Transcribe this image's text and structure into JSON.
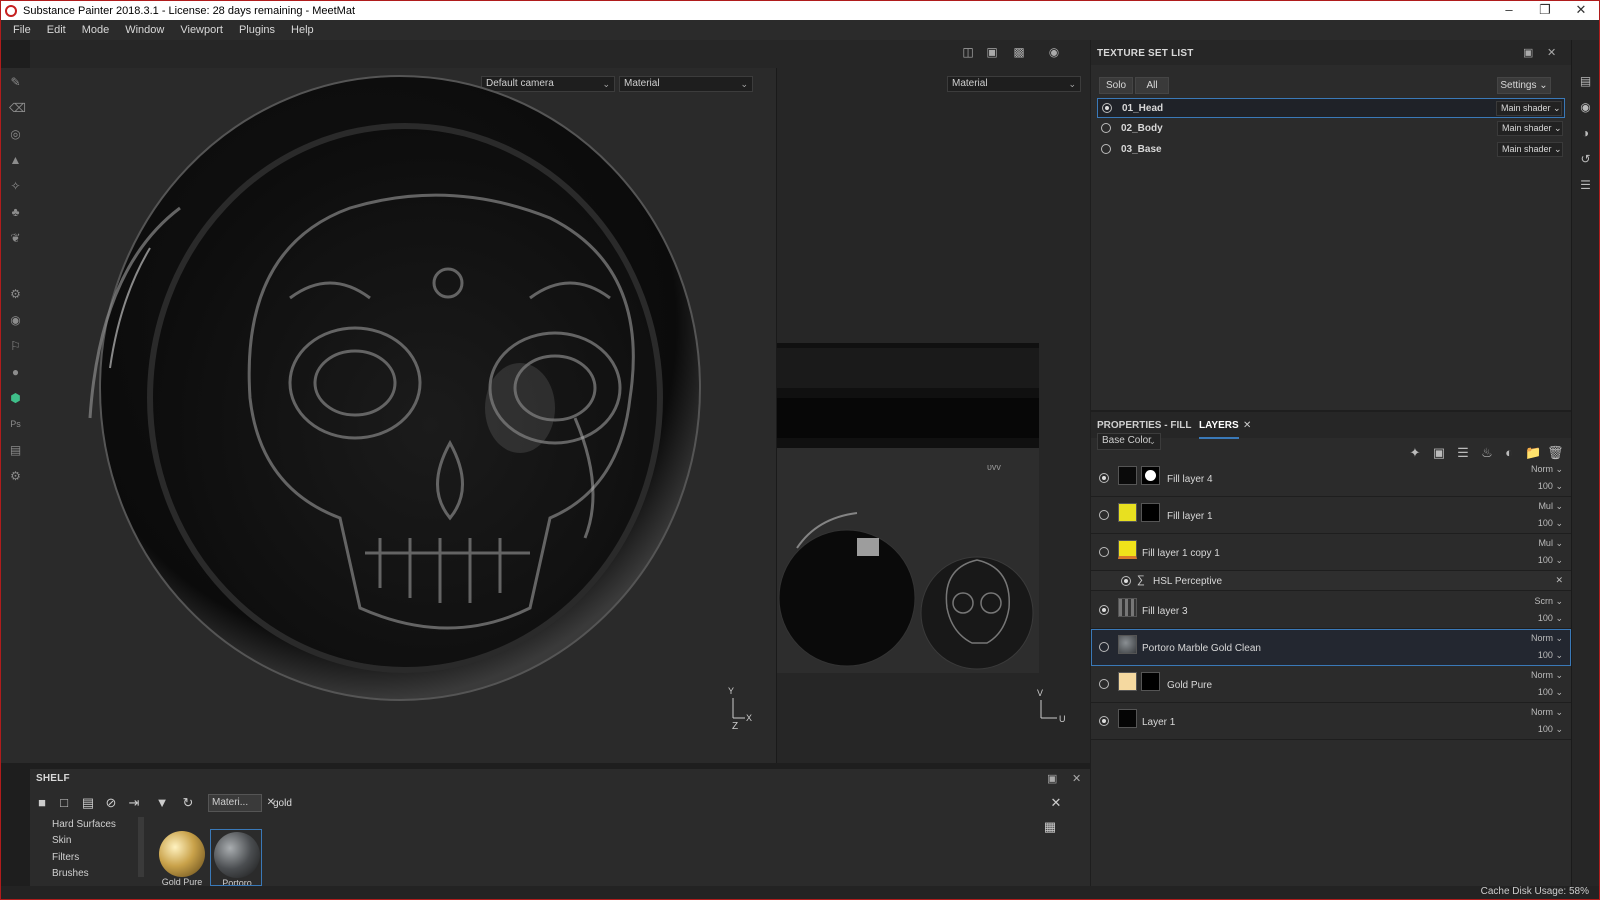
{
  "window": {
    "title": "Substance Painter 2018.3.1 - License: 28 days remaining - MeetMat"
  },
  "menu": [
    "File",
    "Edit",
    "Mode",
    "Window",
    "Viewport",
    "Plugins",
    "Help"
  ],
  "viewport": {
    "camera": "Default camera",
    "mode3d": "Material",
    "mode2d": "Material",
    "axes3d": {
      "y": "Y",
      "z": "Z",
      "x": "X"
    },
    "axes2d": {
      "v": "V",
      "u": "U"
    }
  },
  "texture_set_list": {
    "title": "TEXTURE SET LIST",
    "solo": "Solo",
    "all": "All",
    "settings": "Settings",
    "items": [
      {
        "name": "01_Head",
        "shader": "Main shader",
        "selected": true
      },
      {
        "name": "02_Body",
        "shader": "Main shader",
        "selected": false
      },
      {
        "name": "03_Base",
        "shader": "Main shader",
        "selected": false
      }
    ]
  },
  "layers_panel": {
    "tab_properties": "PROPERTIES - FILL",
    "tab_layers": "LAYERS",
    "channel": "Base Color",
    "layers": [
      {
        "name": "Fill layer 4",
        "blend": "Norm",
        "opacity": "100",
        "color": "#0a0a0a",
        "mask": "#ffffff",
        "visible": true
      },
      {
        "name": "Fill layer 1",
        "blend": "Mul",
        "opacity": "100",
        "color": "#e8e020",
        "mask": "#000000",
        "visible": false
      },
      {
        "name": "Fill layer 1 copy 1",
        "blend": "Mul",
        "opacity": "100",
        "color": "#f0e21a",
        "visible": false
      },
      {
        "name": "HSL Perceptive",
        "effect": true
      },
      {
        "name": "Fill layer 3",
        "blend": "Scrn",
        "opacity": "100",
        "color": "#6a6a6a",
        "visible": true
      },
      {
        "name": "Portoro Marble Gold Clean",
        "blend": "Norm",
        "opacity": "100",
        "color": "#555a5e",
        "visible": false,
        "selected": true
      },
      {
        "name": "Gold Pure",
        "blend": "Norm",
        "opacity": "100",
        "color": "#f5d9a0",
        "mask": "#000000",
        "visible": false
      },
      {
        "name": "Layer 1",
        "blend": "Norm",
        "opacity": "100",
        "color": "#050505",
        "visible": true
      }
    ]
  },
  "shelf": {
    "title": "SHELF",
    "filter_chip": "Materi...",
    "search": "gold",
    "categories": [
      "Hard Surfaces",
      "Skin",
      "Filters",
      "Brushes"
    ],
    "materials": [
      {
        "label": "Gold Pure",
        "color": "#c9a24a"
      },
      {
        "label": "Portoro Ma...",
        "color": "#4a4d50"
      }
    ]
  },
  "status": {
    "cache": "Cache Disk Usage:",
    "cache_value": "58%"
  },
  "colors": {
    "accent": "#3a79b8",
    "window_border": "#b01c1c"
  }
}
